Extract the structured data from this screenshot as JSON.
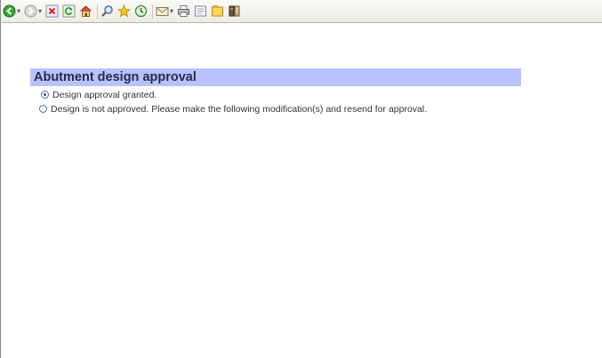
{
  "toolbar": {
    "icons": [
      "back-icon",
      "forward-icon",
      "stop-icon",
      "refresh-icon",
      "home-icon",
      "search-icon",
      "favorites-icon",
      "history-icon",
      "mail-icon",
      "print-icon",
      "edit-icon",
      "discuss-icon",
      "research-icon"
    ]
  },
  "section": {
    "title": "Abutment design approval",
    "header_color": "#b7c2ff",
    "options": [
      {
        "label": "Design approval granted.",
        "selected": true
      },
      {
        "label": "Design is not approved. Please make the following modification(s) and resend for approval.",
        "selected": false
      }
    ]
  }
}
